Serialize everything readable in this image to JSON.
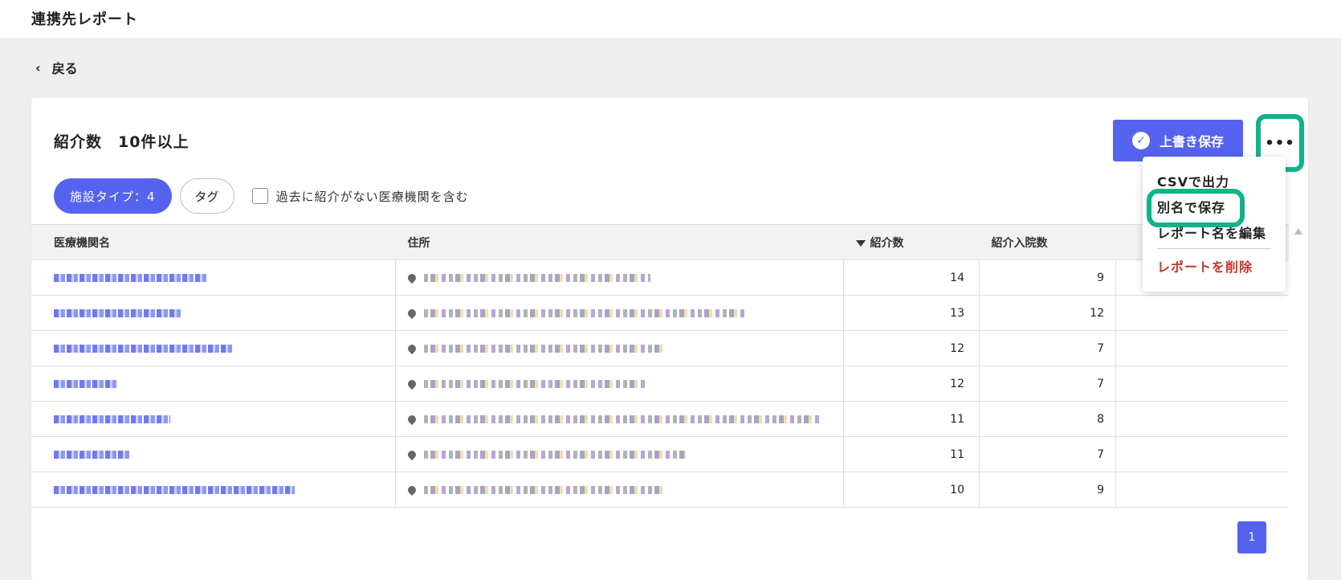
{
  "header": {
    "title": "連携先レポート"
  },
  "nav": {
    "back_label": "戻る",
    "back_icon": "chevron-left-icon"
  },
  "report": {
    "title": "紹介数　10件以上",
    "save_label": "上書き保存",
    "more_label": "•••"
  },
  "filters": {
    "facility_type_chip": "施設タイプ：4",
    "tag_chip": "タグ",
    "include_past_label": "過去に紹介がない医療機関を含む"
  },
  "table": {
    "columns": [
      "医療機関名",
      "住所",
      "紹介数",
      "紹介入院数"
    ],
    "rows": [
      {
        "referrals": "14",
        "admissions": "9"
      },
      {
        "referrals": "13",
        "admissions": "12"
      },
      {
        "referrals": "12",
        "admissions": "7"
      },
      {
        "referrals": "12",
        "admissions": "7"
      },
      {
        "referrals": "11",
        "admissions": "8"
      },
      {
        "referrals": "11",
        "admissions": "7"
      },
      {
        "referrals": "10",
        "admissions": "9"
      }
    ]
  },
  "menu": {
    "items": [
      "CSVで出力",
      "別名で保存",
      "レポート名を編集"
    ],
    "delete_label": "レポートを削除",
    "highlighted_item": "別名で保存"
  },
  "pagination": {
    "current_page": "1"
  },
  "colors": {
    "primary": "#5563ee",
    "highlight": "#10b38a",
    "danger": "#c0392b"
  }
}
